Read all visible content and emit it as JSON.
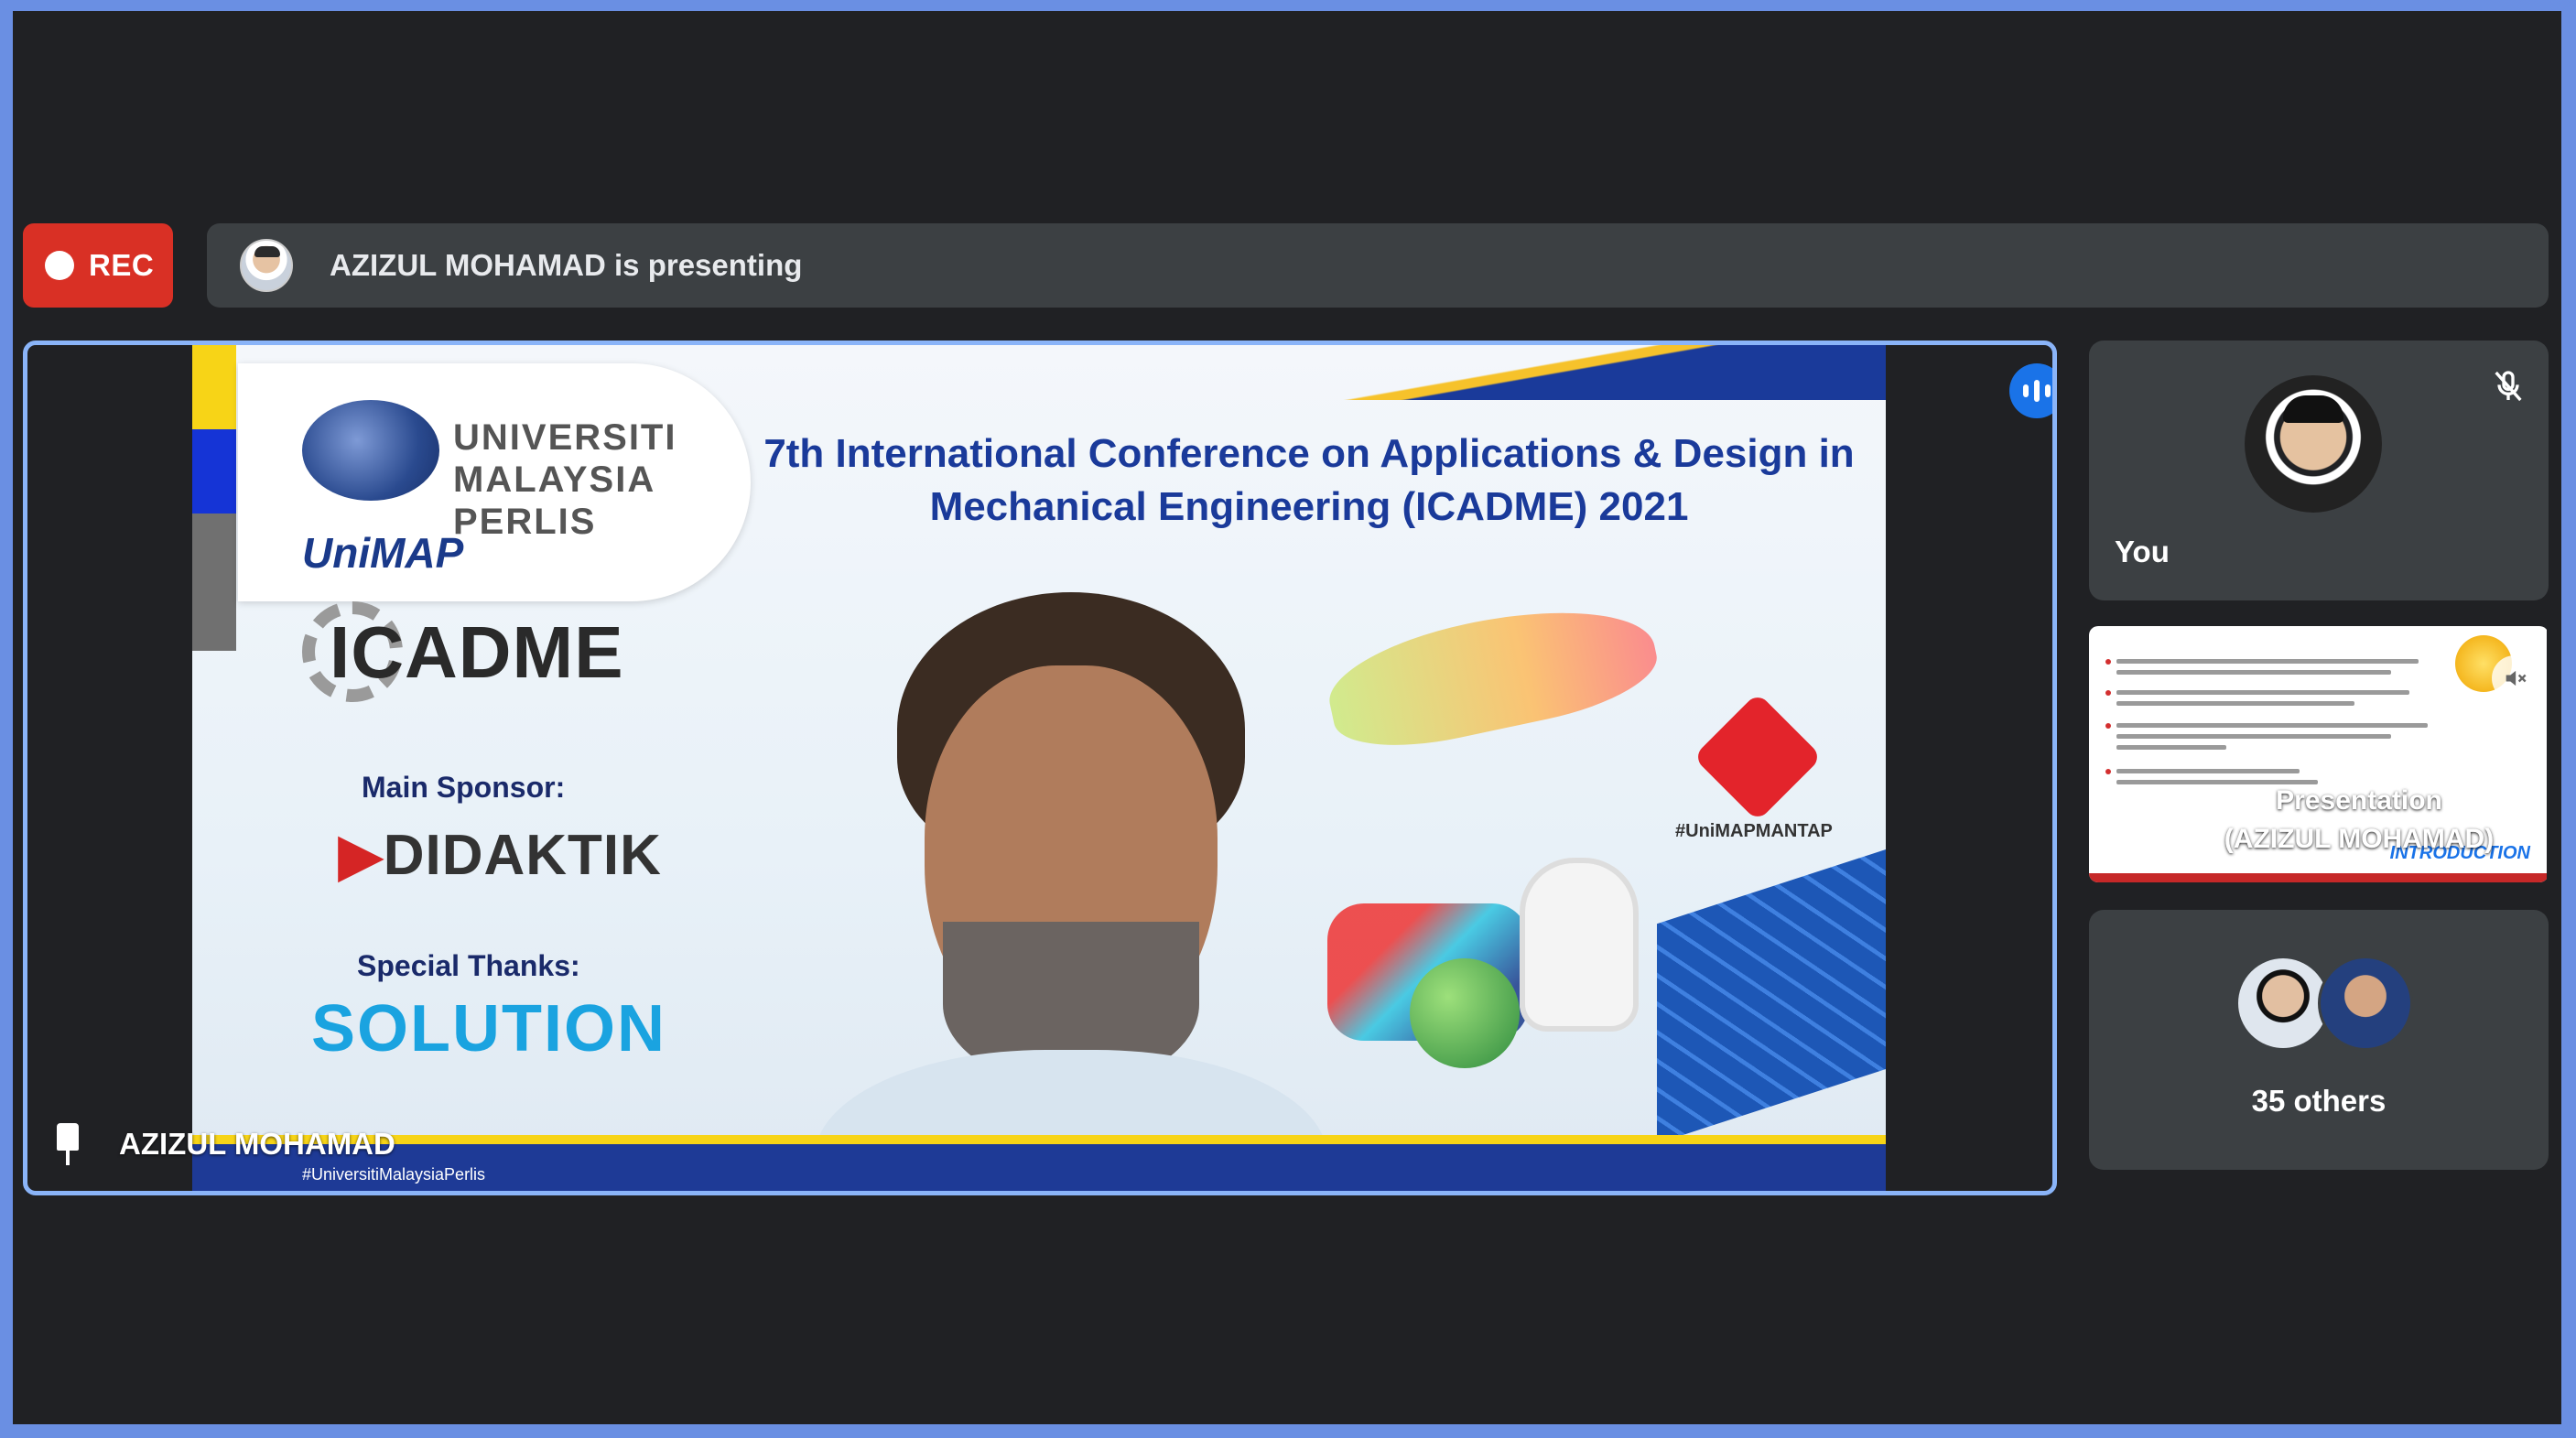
{
  "recording": {
    "label": "REC"
  },
  "presenting_bar": {
    "text": "AZIZUL MOHAMAD is presenting"
  },
  "main_stage": {
    "speaker_name": "AZIZUL MOHAMAD",
    "slide": {
      "university": "UNIVERSITI\nMALAYSIA\nPERLIS",
      "brand": "UniMAP",
      "event": "ICADME",
      "title": "7th International Conference on Applications & Design in Mechanical Engineering (ICADME) 2021",
      "main_sponsor_label": "Main Sponsor:",
      "main_sponsor": "DIDAKTIK",
      "special_thanks_label": "Special Thanks:",
      "special_thanks": "SOLUTION",
      "hashtag": "#UniMAPMANTAP",
      "social_hashtag": "#UniversitiMalaysiaPerlis"
    }
  },
  "tiles": {
    "self": {
      "label": "You"
    },
    "presentation": {
      "label": "Presentation\n(AZIZUL MOHAMAD)",
      "slide_footer": "INTRODUCTION"
    },
    "others": {
      "label": "35 others"
    }
  },
  "colors": {
    "accent": "#1a73e8",
    "rec": "#d93025",
    "tile": "#3c4043",
    "background": "#202124",
    "stage_border": "#8ab4f8"
  },
  "icons": {
    "rec": "record-dot-icon",
    "speaking": "speaking-indicator-icon",
    "pin": "pin-icon",
    "mic_off": "mic-off-icon",
    "present": "presentation-icon"
  }
}
